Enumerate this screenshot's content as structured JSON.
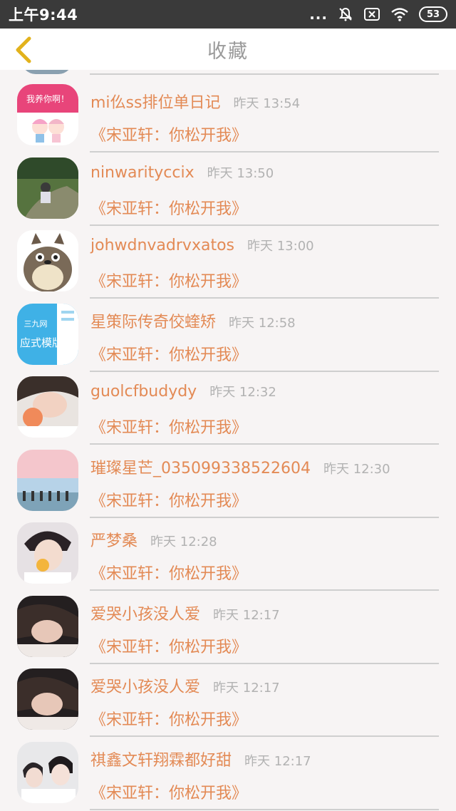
{
  "status_bar": {
    "time": "上午9:44",
    "dots": "...",
    "battery": "53"
  },
  "header": {
    "title": "收藏"
  },
  "items": [
    {
      "user": "mi仫ss排位单日记",
      "time": "昨天 13:54",
      "song": "《宋亚轩：你松开我》",
      "avatar_text": "我养你啊！"
    },
    {
      "user": "ninwarityccix",
      "time": "昨天 13:50",
      "song": "《宋亚轩：你松开我》"
    },
    {
      "user": "johwdnvadrvxatos",
      "time": "昨天 13:00",
      "song": "《宋亚轩：你松开我》"
    },
    {
      "user": "星策际传奇佼蝰矫",
      "time": "昨天 12:58",
      "song": "《宋亚轩：你松开我》",
      "avatar_text_1": "三九网",
      "avatar_text_2": "应式模版"
    },
    {
      "user": "guolcfbudydy",
      "time": "昨天 12:32",
      "song": "《宋亚轩：你松开我》"
    },
    {
      "user": "璀璨星芒_035099338522604",
      "time": "昨天 12:30",
      "song": "《宋亚轩：你松开我》"
    },
    {
      "user": "严梦桑",
      "time": "昨天 12:28",
      "song": "《宋亚轩：你松开我》"
    },
    {
      "user": "爱哭小孩没人爱",
      "time": "昨天 12:17",
      "song": "《宋亚轩：你松开我》"
    },
    {
      "user": "爱哭小孩没人爱",
      "time": "昨天 12:17",
      "song": "《宋亚轩：你松开我》"
    },
    {
      "user": "祺鑫文轩翔霖都好甜",
      "time": "昨天 12:17",
      "song": "《宋亚轩：你松开我》"
    }
  ],
  "colors": {
    "accent": "#e38a55",
    "status_bar": "#3a3a3a",
    "back_arrow": "#e2b21c"
  }
}
